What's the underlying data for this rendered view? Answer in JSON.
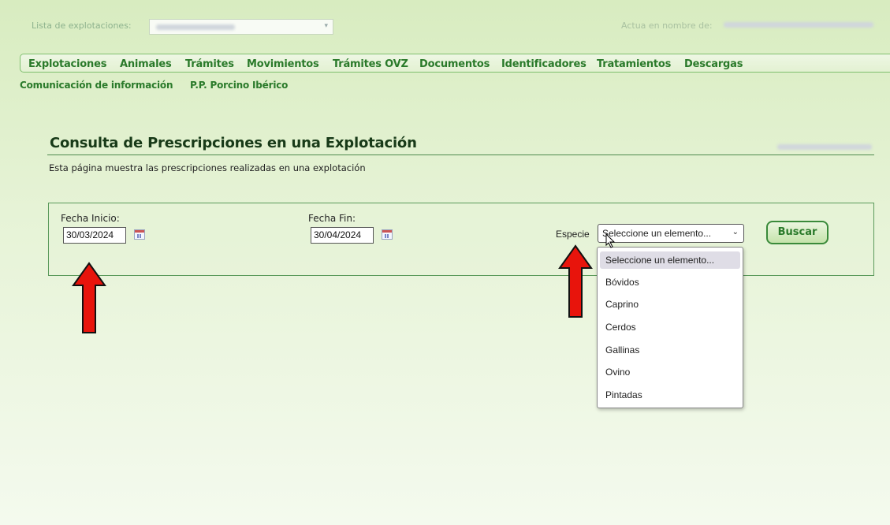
{
  "top": {
    "lista_label": "Lista de explotaciones:",
    "actua_label": "Actua en nombre de:"
  },
  "nav": {
    "items": [
      "Explotaciones",
      "Animales",
      "Trámites",
      "Movimientos",
      "Trámites OVZ",
      "Documentos",
      "Identificadores",
      "Tratamientos",
      "Descargas"
    ],
    "subitems": [
      "Comunicación de información",
      "P.P. Porcino Ibérico"
    ]
  },
  "page": {
    "title": "Consulta de Prescripciones en una Explotación",
    "description": "Esta página muestra las prescripciones realizadas en una explotación"
  },
  "filters": {
    "fecha_inicio_label": "Fecha Inicio:",
    "fecha_inicio_value": "30/03/2024",
    "fecha_fin_label": "Fecha Fin:",
    "fecha_fin_value": "30/04/2024",
    "especie_label": "Especie",
    "especie_selected": "Seleccione un elemento...",
    "especie_options": [
      "Seleccione un elemento...",
      "Bóvidos",
      "Caprino",
      "Cerdos",
      "Gallinas",
      "Ovino",
      "Pintadas"
    ],
    "buscar_label": "Buscar"
  },
  "colors": {
    "accent_green": "#2a7a2a",
    "arrow_red": "#e8140c"
  },
  "icons": [
    "calendar-icon",
    "chevron-down-icon",
    "arrow-up-icon",
    "mouse-cursor-icon"
  ]
}
